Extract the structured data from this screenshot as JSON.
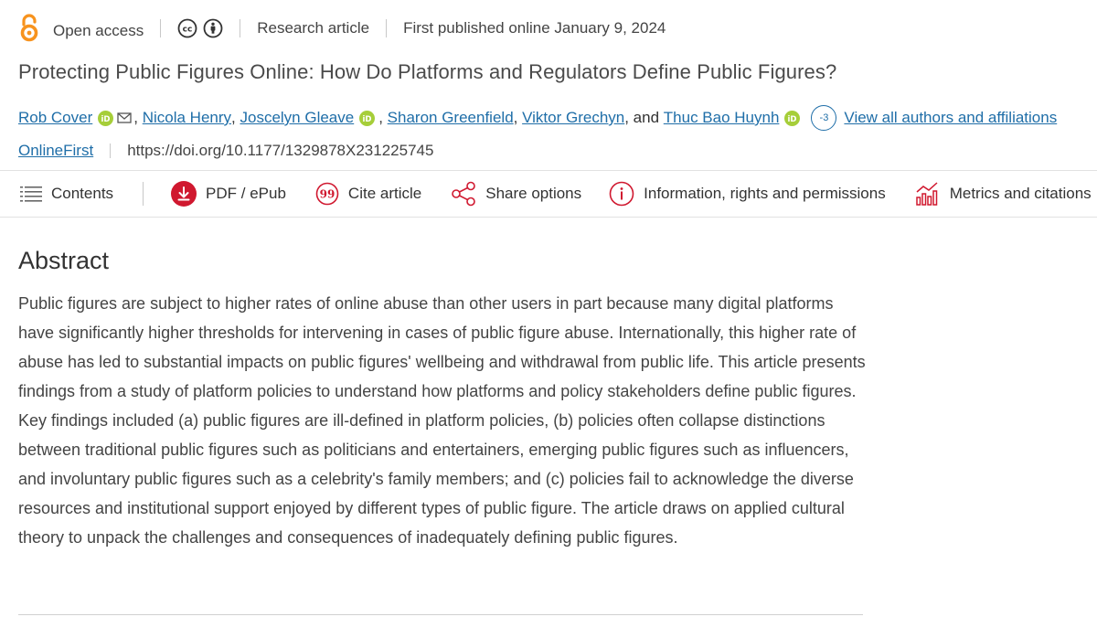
{
  "meta": {
    "open_access_label": "Open access",
    "license_icons": [
      "creative-commons-icon",
      "attribution-icon"
    ],
    "article_type": "Research article",
    "published": "First published online January 9, 2024"
  },
  "title": "Protecting Public Figures Online: How Do Platforms and Regulators Define Public Figures?",
  "authors": {
    "list": [
      {
        "name": "Rob Cover",
        "orcid": true,
        "email": true
      },
      {
        "name": "Nicola Henry",
        "orcid": false,
        "email": false
      },
      {
        "name": "Joscelyn Gleave",
        "orcid": true,
        "email": false
      },
      {
        "name": "Sharon Greenfield",
        "orcid": false,
        "email": false
      },
      {
        "name": "Viktor Grechyn",
        "orcid": false,
        "email": false
      },
      {
        "name": "Thuc Bao Huynh",
        "orcid": true,
        "email": false
      }
    ],
    "conjunction": ", and",
    "more_count": "-3",
    "view_all": "View all authors and affiliations"
  },
  "doi_row": {
    "issue": "OnlineFirst",
    "doi": "https://doi.org/10.1177/1329878X231225745"
  },
  "toolbar": {
    "contents": "Contents",
    "pdf": "PDF / ePub",
    "cite": "Cite article",
    "share": "Share options",
    "info": "Information, rights and permissions",
    "metrics": "Metrics and citations"
  },
  "abstract": {
    "heading": "Abstract",
    "body": "Public figures are subject to higher rates of online abuse than other users in part because many digital platforms have significantly higher thresholds for intervening in cases of public figure abuse. Internationally, this higher rate of abuse has led to substantial impacts on public figures' wellbeing and withdrawal from public life. This article presents findings from a study of platform policies to understand how platforms and policy stakeholders define public figures. Key findings included (a) public figures are ill-defined in platform policies, (b) policies often collapse distinctions between traditional public figures such as politicians and entertainers, emerging public figures such as influencers, and involuntary public figures such as a celebrity's family members; and (c) policies fail to acknowledge the diverse resources and institutional support enjoyed by different types of public figure. The article draws on applied cultural theory to unpack the challenges and consequences of inadequately defining public figures."
  },
  "colors": {
    "link": "#1f6ea8",
    "open_access": "#f7931e",
    "orcid": "#a6ce39",
    "toolbar_icon": "#d0182f"
  }
}
